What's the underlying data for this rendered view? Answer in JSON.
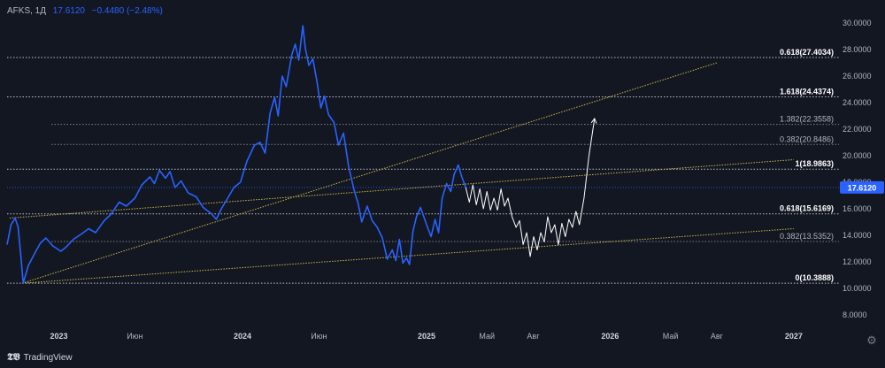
{
  "legend": {
    "symbol": "AFKS, 1Д",
    "price": "17.6120",
    "change": "−0.4480 (−2.48%)"
  },
  "branding": {
    "text": "TradingView",
    "logo_icon": "tradingview-logo-icon"
  },
  "settings_icon": "gear-icon",
  "colors": {
    "background": "#131722",
    "price_line": "#2962ff",
    "projection": "#ffffff",
    "trend_lines": "#c9b84a",
    "fib_lines": "#d1d4dc",
    "current_price_badge": "#2962ff",
    "axis_text": "#b2b5be"
  },
  "chart_data": {
    "type": "line",
    "title": "",
    "y_axis": {
      "range": [
        7.2,
        31.2
      ],
      "ticks": [
        "8.0000",
        "10.0000",
        "12.0000",
        "14.0000",
        "16.0000",
        "18.0000",
        "20.0000",
        "22.0000",
        "24.0000",
        "26.0000",
        "28.0000",
        "30.0000"
      ],
      "side": "right"
    },
    "x_axis": {
      "range": [
        "2022-09-20",
        "2027-04-01"
      ],
      "ticks": [
        {
          "label": "2023",
          "date": "2023-01-01"
        },
        {
          "label": "Июн",
          "date": "2023-06-01"
        },
        {
          "label": "2024",
          "date": "2024-01-01"
        },
        {
          "label": "Июн",
          "date": "2024-06-01"
        },
        {
          "label": "2025",
          "date": "2025-01-01"
        },
        {
          "label": "Май",
          "date": "2025-05-01"
        },
        {
          "label": "Авг",
          "date": "2025-08-01"
        },
        {
          "label": "2026",
          "date": "2026-01-01"
        },
        {
          "label": "Май",
          "date": "2026-05-01"
        },
        {
          "label": "Авг",
          "date": "2026-08-01"
        },
        {
          "label": "2027",
          "date": "2027-01-01"
        }
      ]
    },
    "grid": false,
    "current_price": {
      "label": "17.6120",
      "value": 17.612
    },
    "fib_levels": [
      {
        "label": "0.618(27.4034)",
        "value": 27.4034,
        "bold": true
      },
      {
        "label": "1.618(24.4374)",
        "value": 24.4374,
        "bold": true
      },
      {
        "label": "1.382(22.3558)",
        "value": 22.3558,
        "bold": false
      },
      {
        "label": "0.382(20.8486)",
        "value": 20.8486,
        "bold": false
      },
      {
        "label": "1(18.9863)",
        "value": 18.9863,
        "bold": true
      },
      {
        "label": "0.618(15.6169)",
        "value": 15.6169,
        "bold": true
      },
      {
        "label": "0.382(13.5352)",
        "value": 13.5352,
        "bold": false
      },
      {
        "label": "0(10.3888)",
        "value": 10.3888,
        "bold": true
      }
    ],
    "trend_lines": [
      {
        "from": {
          "date": "2022-10-20",
          "value": 10.3888
        },
        "to": {
          "date": "2026-08-01",
          "value": 27.0
        }
      },
      {
        "from": {
          "date": "2022-09-25",
          "value": 15.3
        },
        "to": {
          "date": "2027-01-01",
          "value": 19.7
        }
      },
      {
        "from": {
          "date": "2022-10-20",
          "value": 10.3888
        },
        "to": {
          "date": "2027-01-01",
          "value": 14.5
        }
      }
    ],
    "series": [
      {
        "name": "AFKS",
        "style": "price",
        "points": [
          [
            "2022-09-20",
            13.3
          ],
          [
            "2022-09-28",
            14.8
          ],
          [
            "2022-10-06",
            15.3
          ],
          [
            "2022-10-12",
            14.6
          ],
          [
            "2022-10-18",
            12.2
          ],
          [
            "2022-10-22",
            10.4
          ],
          [
            "2022-11-01",
            11.7
          ],
          [
            "2022-11-12",
            12.5
          ],
          [
            "2022-11-25",
            13.4
          ],
          [
            "2022-12-06",
            13.8
          ],
          [
            "2022-12-20",
            13.2
          ],
          [
            "2023-01-05",
            12.8
          ],
          [
            "2023-01-15",
            13.1
          ],
          [
            "2023-01-30",
            13.7
          ],
          [
            "2023-02-15",
            14.1
          ],
          [
            "2023-03-01",
            14.5
          ],
          [
            "2023-03-15",
            14.2
          ],
          [
            "2023-04-01",
            15.1
          ],
          [
            "2023-04-15",
            15.6
          ],
          [
            "2023-05-01",
            16.5
          ],
          [
            "2023-05-15",
            16.2
          ],
          [
            "2023-06-01",
            16.8
          ],
          [
            "2023-06-15",
            17.8
          ],
          [
            "2023-07-01",
            18.4
          ],
          [
            "2023-07-10",
            17.9
          ],
          [
            "2023-07-20",
            18.9
          ],
          [
            "2023-08-01",
            18.3
          ],
          [
            "2023-08-10",
            18.8
          ],
          [
            "2023-08-20",
            17.6
          ],
          [
            "2023-09-01",
            18.1
          ],
          [
            "2023-09-15",
            17.2
          ],
          [
            "2023-10-01",
            16.9
          ],
          [
            "2023-10-15",
            16.1
          ],
          [
            "2023-11-01",
            15.6
          ],
          [
            "2023-11-10",
            15.2
          ],
          [
            "2023-11-20",
            16.0
          ],
          [
            "2023-12-01",
            16.7
          ],
          [
            "2023-12-15",
            17.6
          ],
          [
            "2023-12-28",
            18.0
          ],
          [
            "2024-01-10",
            19.6
          ],
          [
            "2024-01-25",
            20.8
          ],
          [
            "2024-02-05",
            21.0
          ],
          [
            "2024-02-15",
            20.2
          ],
          [
            "2024-02-25",
            23.2
          ],
          [
            "2024-03-05",
            24.4
          ],
          [
            "2024-03-12",
            23.0
          ],
          [
            "2024-03-20",
            26.0
          ],
          [
            "2024-03-28",
            25.2
          ],
          [
            "2024-04-08",
            27.6
          ],
          [
            "2024-04-15",
            28.4
          ],
          [
            "2024-04-22",
            27.2
          ],
          [
            "2024-04-30",
            29.8
          ],
          [
            "2024-05-05",
            28.1
          ],
          [
            "2024-05-12",
            26.8
          ],
          [
            "2024-05-20",
            27.3
          ],
          [
            "2024-05-28",
            25.6
          ],
          [
            "2024-06-05",
            23.6
          ],
          [
            "2024-06-12",
            24.5
          ],
          [
            "2024-06-20",
            23.1
          ],
          [
            "2024-07-01",
            22.5
          ],
          [
            "2024-07-10",
            20.8
          ],
          [
            "2024-07-20",
            21.7
          ],
          [
            "2024-07-30",
            19.2
          ],
          [
            "2024-08-10",
            17.4
          ],
          [
            "2024-08-18",
            16.4
          ],
          [
            "2024-08-25",
            15.0
          ],
          [
            "2024-09-05",
            16.2
          ],
          [
            "2024-09-15",
            15.1
          ],
          [
            "2024-09-25",
            14.6
          ],
          [
            "2024-10-05",
            13.8
          ],
          [
            "2024-10-15",
            12.2
          ],
          [
            "2024-10-25",
            12.9
          ],
          [
            "2024-11-01",
            12.1
          ],
          [
            "2024-11-08",
            13.7
          ],
          [
            "2024-11-15",
            11.9
          ],
          [
            "2024-11-22",
            12.3
          ],
          [
            "2024-11-28",
            11.8
          ],
          [
            "2024-12-05",
            14.3
          ],
          [
            "2024-12-12",
            15.4
          ],
          [
            "2024-12-20",
            16.1
          ],
          [
            "2025-01-01",
            14.8
          ],
          [
            "2025-01-10",
            13.9
          ],
          [
            "2025-01-18",
            15.2
          ],
          [
            "2025-01-25",
            14.2
          ],
          [
            "2025-02-01",
            16.8
          ],
          [
            "2025-02-10",
            17.9
          ],
          [
            "2025-02-18",
            17.3
          ],
          [
            "2025-02-25",
            18.6
          ],
          [
            "2025-03-05",
            19.3
          ],
          [
            "2025-03-12",
            18.4
          ],
          [
            "2025-03-20",
            17.6
          ]
        ]
      },
      {
        "name": "",
        "style": "projection",
        "points": [
          [
            "2025-03-20",
            17.6
          ],
          [
            "2025-03-27",
            16.5
          ],
          [
            "2025-04-03",
            17.8
          ],
          [
            "2025-04-10",
            16.3
          ],
          [
            "2025-04-17",
            17.5
          ],
          [
            "2025-04-24",
            16.0
          ],
          [
            "2025-05-01",
            17.3
          ],
          [
            "2025-05-08",
            15.9
          ],
          [
            "2025-05-15",
            16.8
          ],
          [
            "2025-05-22",
            15.9
          ],
          [
            "2025-05-29",
            17.5
          ],
          [
            "2025-06-05",
            16.2
          ],
          [
            "2025-06-12",
            16.8
          ],
          [
            "2025-06-20",
            15.4
          ],
          [
            "2025-06-28",
            14.6
          ],
          [
            "2025-07-05",
            15.1
          ],
          [
            "2025-07-12",
            13.3
          ],
          [
            "2025-07-19",
            14.2
          ],
          [
            "2025-07-26",
            12.4
          ],
          [
            "2025-08-02",
            13.9
          ],
          [
            "2025-08-09",
            12.9
          ],
          [
            "2025-08-16",
            14.2
          ],
          [
            "2025-08-23",
            13.5
          ],
          [
            "2025-08-30",
            15.4
          ],
          [
            "2025-09-06",
            14.2
          ],
          [
            "2025-09-13",
            14.8
          ],
          [
            "2025-09-20",
            13.3
          ],
          [
            "2025-09-27",
            14.9
          ],
          [
            "2025-10-04",
            13.9
          ],
          [
            "2025-10-11",
            15.2
          ],
          [
            "2025-10-18",
            14.6
          ],
          [
            "2025-10-25",
            15.8
          ],
          [
            "2025-11-01",
            14.8
          ],
          [
            "2025-11-10",
            16.8
          ],
          [
            "2025-11-20",
            20.0
          ],
          [
            "2025-12-01",
            22.8
          ]
        ]
      }
    ]
  }
}
